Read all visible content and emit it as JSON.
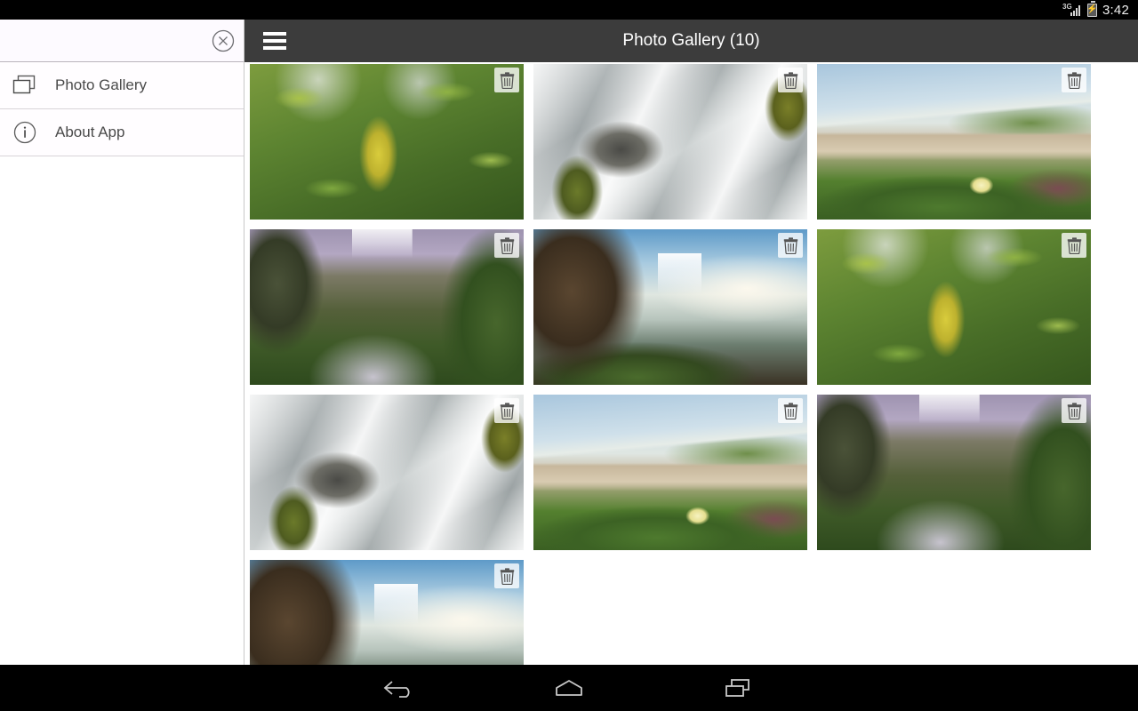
{
  "status_bar": {
    "network_label": "3G",
    "time": "3:42",
    "signal_icon": "signal-bars-icon",
    "battery_icon": "battery-charging-icon"
  },
  "app_bar": {
    "menu_icon": "hamburger-menu-icon",
    "title": "Photo Gallery (10)",
    "background_color": "#3c3c3c",
    "title_color": "#ffffff"
  },
  "drawer": {
    "close_icon": "close-circle-icon",
    "items": [
      {
        "label": "Photo Gallery",
        "icon": "gallery-stack-icon"
      },
      {
        "label": "About App",
        "icon": "info-circle-icon"
      }
    ]
  },
  "gallery": {
    "delete_icon": "trash-can-icon",
    "photo_count": 10,
    "columns": 3,
    "photos": [
      {
        "id": 1,
        "alt": "Green leaves with one yellow leaf backlit by sun",
        "art": "ph-leaves"
      },
      {
        "id": 2,
        "alt": "Long exposure white water rapids over mossy rock",
        "art": "ph-rapids"
      },
      {
        "id": 3,
        "alt": "Beach dune with grass, succulents and white flower",
        "art": "ph-dune"
      },
      {
        "id": 4,
        "alt": "Skogafoss waterfall under purple stormy sky",
        "art": "ph-skogafoss"
      },
      {
        "id": 5,
        "alt": "Godafoss waterfall with rocky cliff and blue sky",
        "art": "ph-godafoss"
      },
      {
        "id": 6,
        "alt": "Green leaves with one yellow leaf backlit by sun",
        "art": "ph-leaves"
      },
      {
        "id": 7,
        "alt": "Long exposure white water rapids over mossy rock",
        "art": "ph-rapids"
      },
      {
        "id": 8,
        "alt": "Beach dune with grass, succulents and white flower",
        "art": "ph-dune"
      },
      {
        "id": 9,
        "alt": "Skogafoss waterfall under purple stormy sky",
        "art": "ph-skogafoss"
      },
      {
        "id": 10,
        "alt": "Godafoss waterfall with rocky cliff and blue sky",
        "art": "ph-godafoss"
      }
    ]
  },
  "nav_bar": {
    "buttons": [
      {
        "name": "back",
        "icon": "back-arrow-icon"
      },
      {
        "name": "home",
        "icon": "home-icon"
      },
      {
        "name": "recents",
        "icon": "recents-icon"
      }
    ]
  }
}
